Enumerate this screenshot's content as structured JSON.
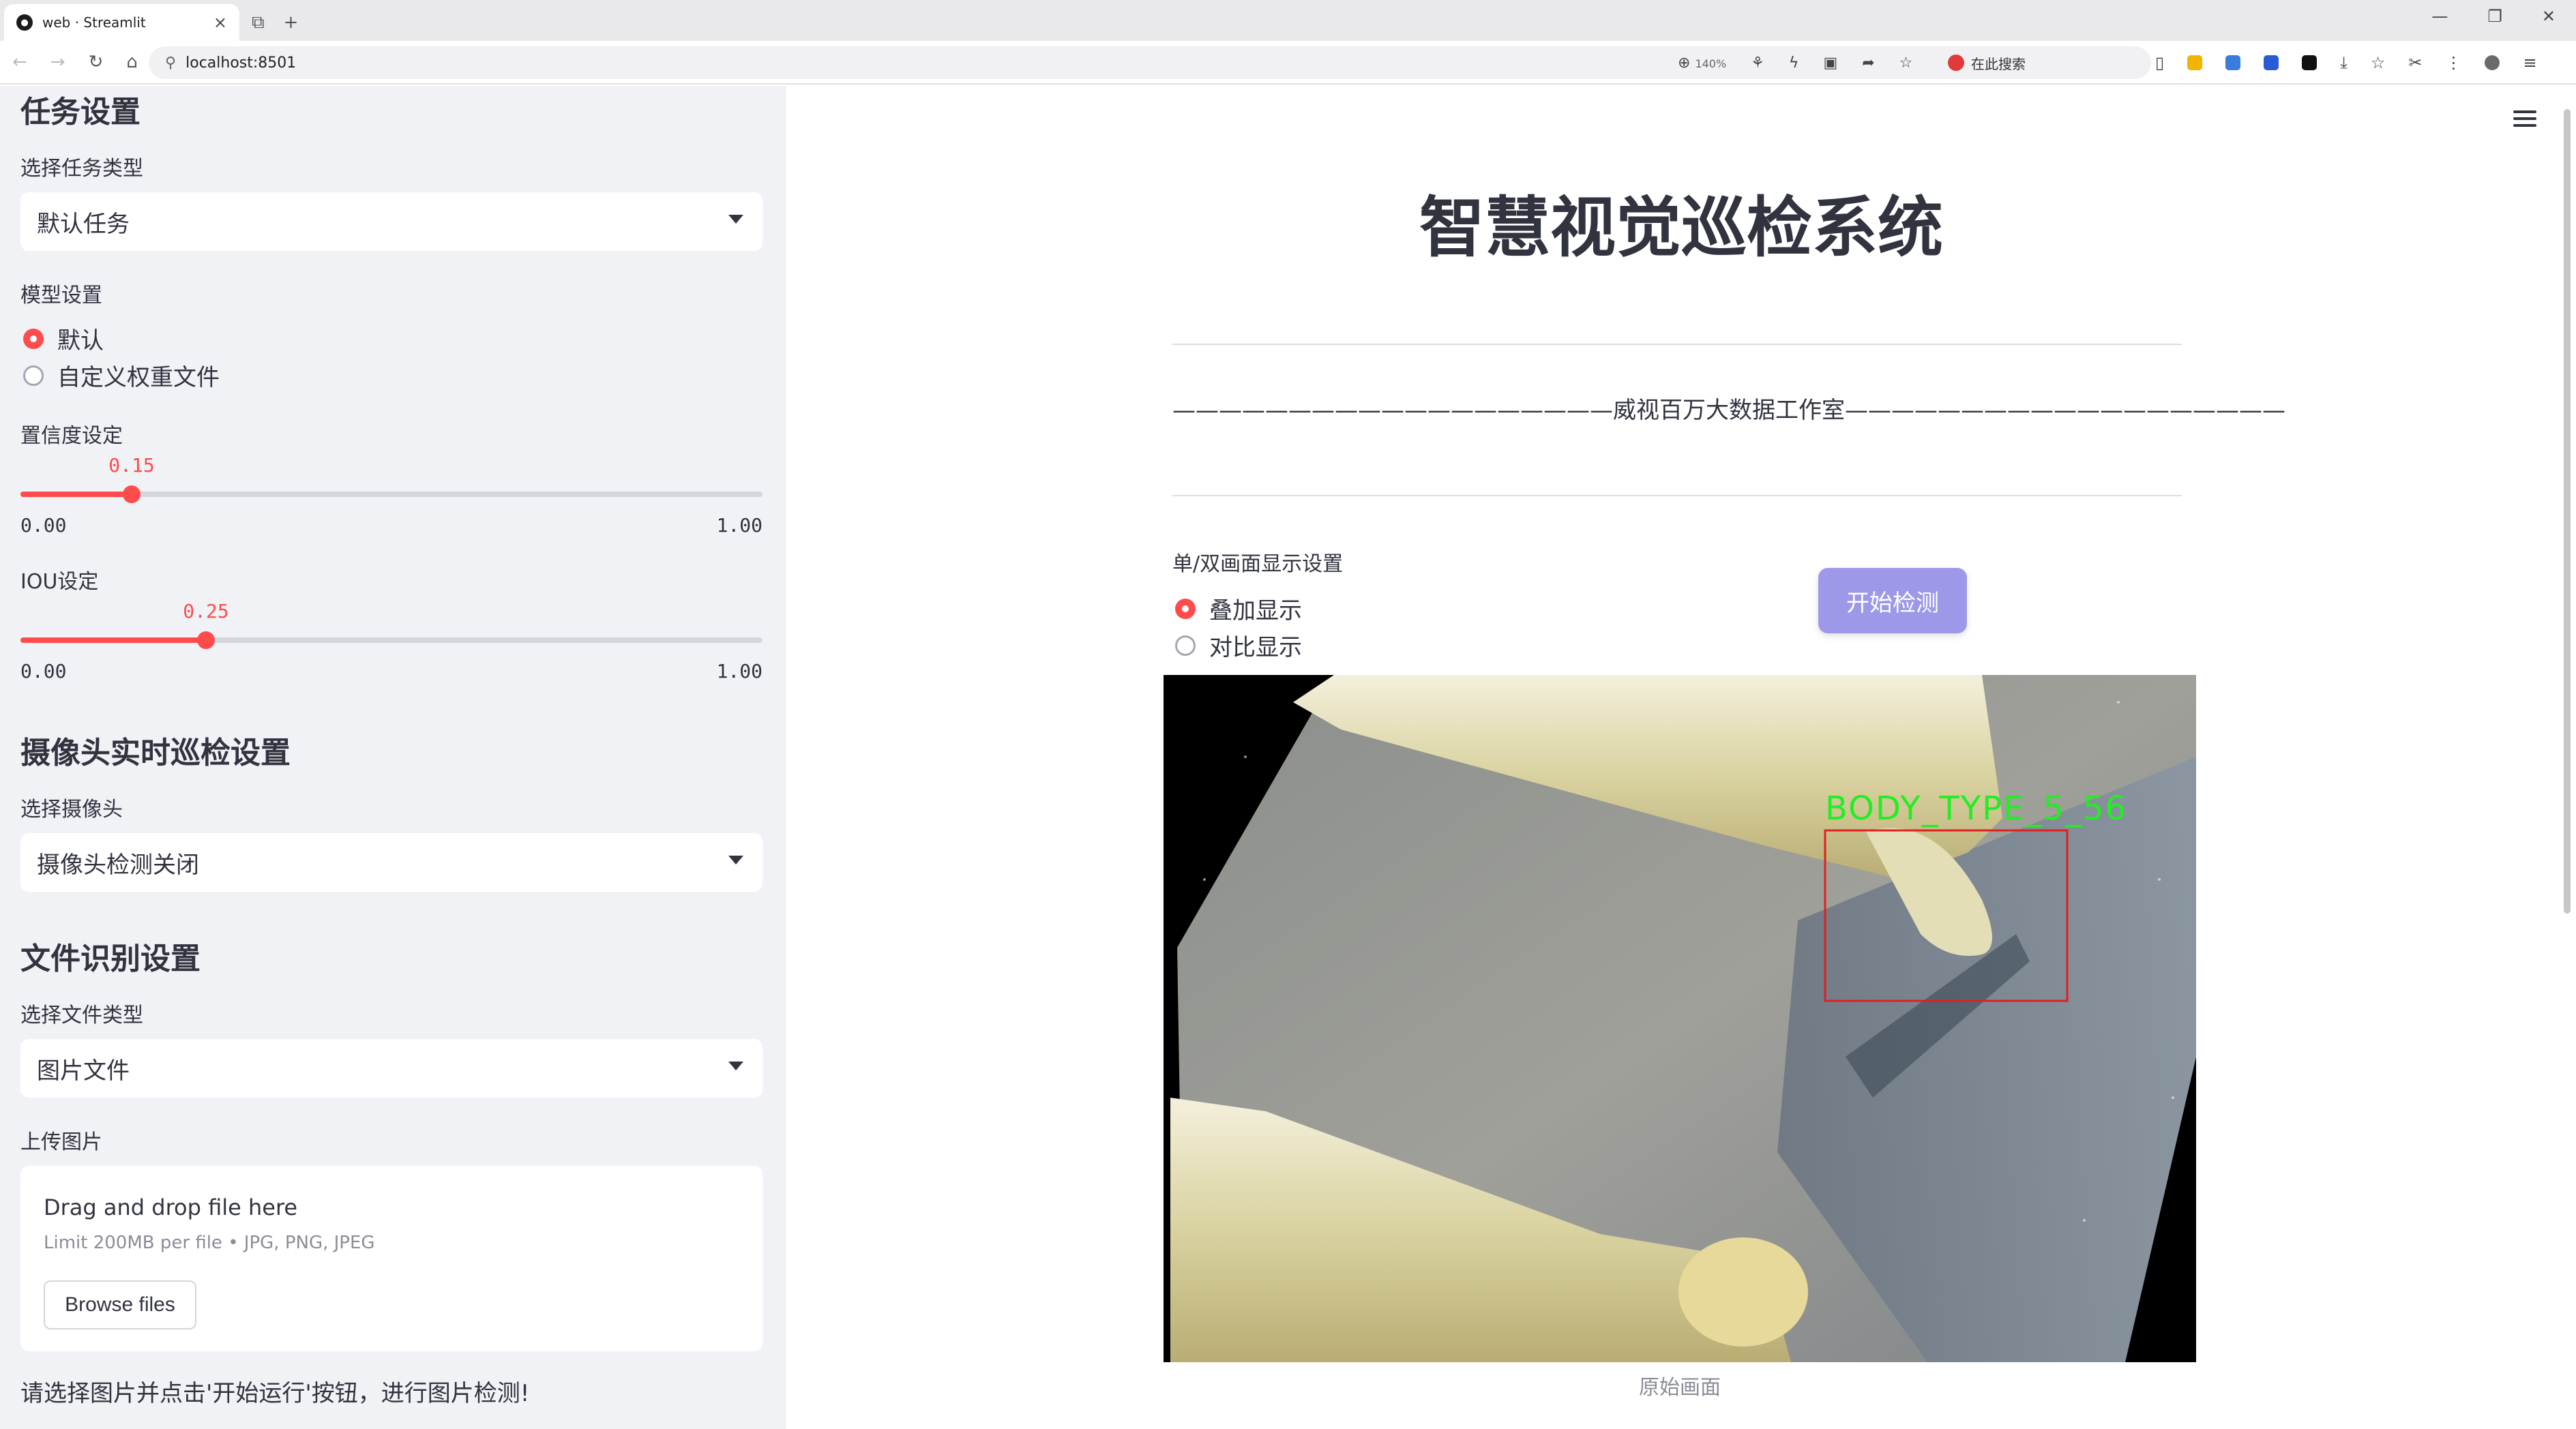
{
  "browser": {
    "tab_title": "web · Streamlit",
    "tab_close": "×",
    "new_tab": "+",
    "url": "localhost:8501",
    "zoom": "140%",
    "search_label": "在此搜索"
  },
  "sidebar": {
    "task_section_title": "任务设置",
    "task_type_label": "选择任务类型",
    "task_type_value": "默认任务",
    "model_label": "模型设置",
    "model_options": [
      "默认",
      "自定义权重文件"
    ],
    "model_selected": 0,
    "confidence_label": "置信度设定",
    "confidence": {
      "value": 0.15,
      "value_text": "0.15",
      "min": "0.00",
      "max": "1.00"
    },
    "iou_label": "IOU设定",
    "iou": {
      "value": 0.25,
      "value_text": "0.25",
      "min": "0.00",
      "max": "1.00"
    },
    "camera_section_title": "摄像头实时巡检设置",
    "camera_label": "选择摄像头",
    "camera_value": "摄像头检测关闭",
    "file_section_title": "文件识别设置",
    "file_type_label": "选择文件类型",
    "file_type_value": "图片文件",
    "upload_label": "上传图片",
    "uploader": {
      "drop_text": "Drag and drop file here",
      "limit_text": "Limit 200MB per file • JPG, PNG, JPEG",
      "browse_label": "Browse files"
    },
    "note": "请选择图片并点击'开始运行'按钮，进行图片检测!"
  },
  "main": {
    "title": "智慧视觉巡检系统",
    "subtitle": "———————————————————威视百万大数据工作室———————————————————",
    "display_label": "单/双画面显示设置",
    "display_options": [
      "叠加显示",
      "对比显示"
    ],
    "display_selected": 0,
    "start_button": "开始检测",
    "detection_label": "BODY_TYPE_5_56",
    "caption": "原始画面"
  },
  "colors": {
    "accent": "#ff4b4b",
    "button": "#9d99e8",
    "detection_box": "#e02020",
    "detection_text": "#22ee22"
  }
}
